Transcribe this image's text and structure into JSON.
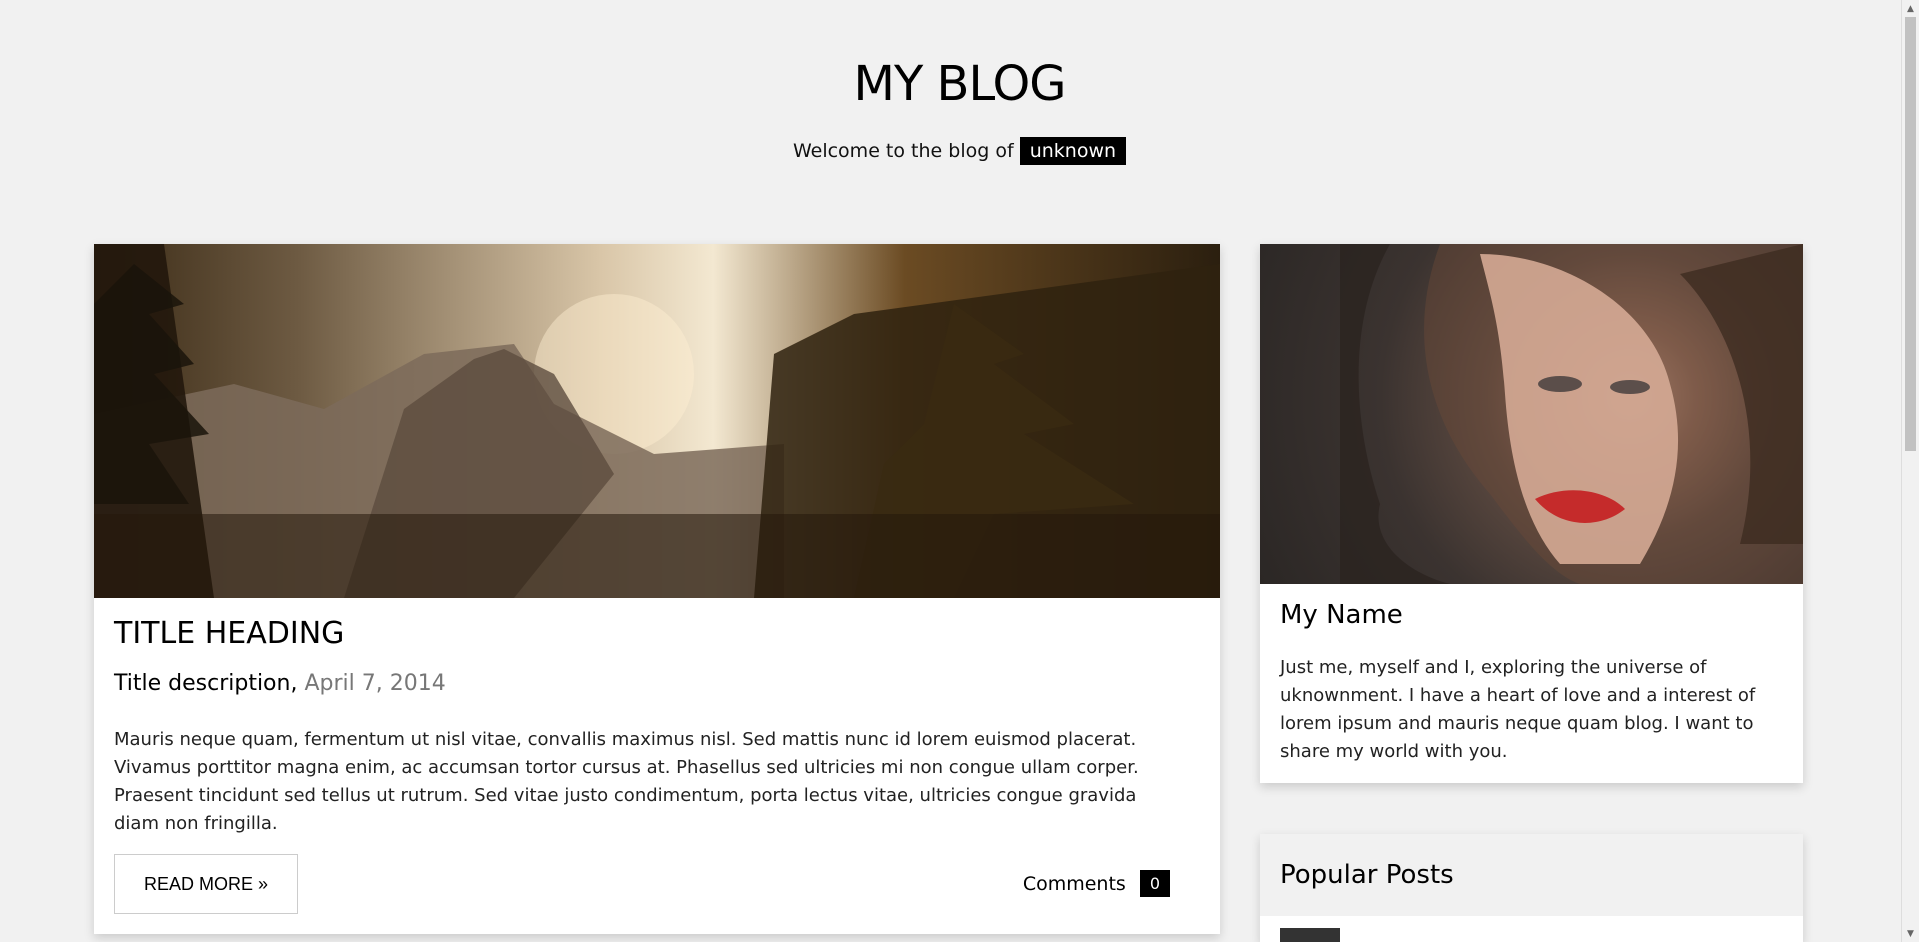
{
  "header": {
    "title": "MY BLOG",
    "welcome_text": "Welcome to the blog of",
    "user_tag": "unknown"
  },
  "post": {
    "title": "TITLE HEADING",
    "subtitle": "Title description,",
    "date": "April 7, 2014",
    "body": "Mauris neque quam, fermentum ut nisl vitae, convallis maximus nisl. Sed mattis nunc id lorem euismod placerat. Vivamus porttitor magna enim, ac accumsan tortor cursus at. Phasellus sed ultricies mi non congue ullam corper. Praesent tincidunt sed tellus ut rutrum. Sed vitae justo condimentum, porta lectus vitae, ultricies congue gravida diam non fringilla.",
    "read_more_label": "READ MORE »",
    "comments_label": "Comments",
    "comments_count": "0"
  },
  "profile": {
    "name": "My Name",
    "bio": "Just me, myself and I, exploring the universe of uknownment. I have a heart of love and a interest of lorem ipsum and mauris neque quam blog. I want to share my world with you."
  },
  "popular": {
    "title": "Popular Posts"
  },
  "icons": {
    "scroll_up": "scroll-up-arrow-icon",
    "scroll_down": "scroll-down-arrow-icon"
  }
}
